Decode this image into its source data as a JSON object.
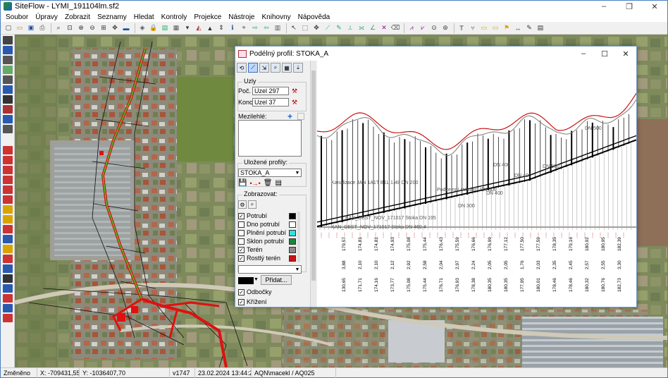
{
  "app": {
    "title": "SiteFlow - LYMI_191104lm.sf2",
    "controls": [
      "–",
      "❐",
      "✕"
    ]
  },
  "menu": [
    "Soubor",
    "Úpravy",
    "Zobrazit",
    "Seznamy",
    "Hledat",
    "Kontroly",
    "Projekce",
    "Nástroje",
    "Knihovny",
    "Nápověda"
  ],
  "toolbar": {
    "icons": [
      "new-file-icon",
      "open-folder-icon",
      "save-icon",
      "print-icon",
      "zoom-icon",
      "zoom-window-icon",
      "zoom-in-icon",
      "zoom-out-icon",
      "zoom-all-icon",
      "pan-icon",
      "ruler-icon",
      "layer-icon",
      "lock-icon",
      "tag-icon",
      "table-icon",
      "dropdown-icon",
      "map-icon",
      "pin-icon",
      "lift-icon",
      "info-icon",
      "plot-icon",
      "export-icon",
      "import-icon",
      "print-setup-icon",
      "select-icon",
      "select-rect-icon",
      "move-icon",
      "pipe-icon",
      "pipe-edit-icon",
      "pipe-split-icon",
      "pipe-join-icon",
      "pipe-angle-icon",
      "cross-icon",
      "delete-icon",
      "profile-icon",
      "profile-edit-icon",
      "node-icon",
      "node-edit-icon",
      "text-icon",
      "branch-icon",
      "label-icon",
      "label-edit-icon",
      "flag-icon",
      "dim-icon",
      "note-icon",
      "doc-icon"
    ]
  },
  "statusbar": {
    "state": "Změněno",
    "x": "X: -709431,55",
    "y": "Y: -1036407,70",
    "version": "v1747",
    "datetime": "23.02.2024 13:44:23",
    "user": "AQN\\macekl / AQ025"
  },
  "dialog": {
    "title": "Podélný profil: STOKA_A",
    "controls": [
      "–",
      "☐",
      "✕"
    ],
    "nodes_group": "Uzly",
    "start_label": "Poč.",
    "start_value": "Uzel 297",
    "end_label": "Konc.",
    "end_value": "Uzel 37",
    "intermediate_label": "Mezilehlé:",
    "saved_profiles_label": "Uložené profily:",
    "saved_profile_value": "STOKA_A",
    "display_label": "Zobrazovat:",
    "layers": [
      {
        "label": "Potrubí",
        "checked": true,
        "color": "#000000"
      },
      {
        "label": "Dno potrubí",
        "checked": false,
        "color": "#ffffff"
      },
      {
        "label": "Plnění potrubí",
        "checked": false,
        "color": "#33e0e0"
      },
      {
        "label": "Sklon potrubí",
        "checked": false,
        "color": "#138a3a"
      },
      {
        "label": "Terén",
        "checked": true,
        "color": "#8a8a8a"
      },
      {
        "label": "Rostlý terén",
        "checked": true,
        "color": "#cc1111"
      }
    ],
    "add_button": "Přidat...",
    "checkboxes": [
      {
        "label": "Odbočky",
        "checked": true
      },
      {
        "label": "Křížení",
        "checked": true
      }
    ],
    "profile_labels": [
      "Kanalizace JAN 1A1T B1L 1.48 DN 200",
      "Podzemní stávající DN 300",
      "DN 400",
      "DN 400",
      "KAN_DEST_NOV_171017 Stoka DN 195",
      "KAN_DEST_NOV_171017 Stoka DN 469,4",
      "DN 500",
      "DN 300",
      "DN 400",
      "DN 500"
    ],
    "table_rows": [
      [
        "179,57",
        "174,81",
        "174,81",
        "174,93",
        "175,08",
        "175,44",
        "176,43",
        "175,59",
        "176,66",
        "176,99",
        "177,12",
        "177,50",
        "177,59",
        "178,35",
        "179,16",
        "180,92",
        "180,95",
        "182,39"
      ],
      [
        "3,88",
        "2,10",
        "2,10",
        "2,12",
        "2,92",
        "2,58",
        "2,04",
        "2,97",
        "2,24",
        "2,05",
        "2,05",
        "1,76",
        "2,03",
        "2,35",
        "2,45",
        "2,57",
        "2,55",
        "3,30"
      ],
      [
        "130,65",
        "171,71",
        "174,16",
        "173,77",
        "175,08",
        "175,44",
        "176,71",
        "176,93",
        "178,38",
        "180,35",
        "180,35",
        "177,95",
        "180,01",
        "178,46",
        "178,46",
        "180,32",
        "180,76",
        "182,73"
      ]
    ]
  },
  "map_labels": [
    "Kanalizace DN 200"
  ]
}
